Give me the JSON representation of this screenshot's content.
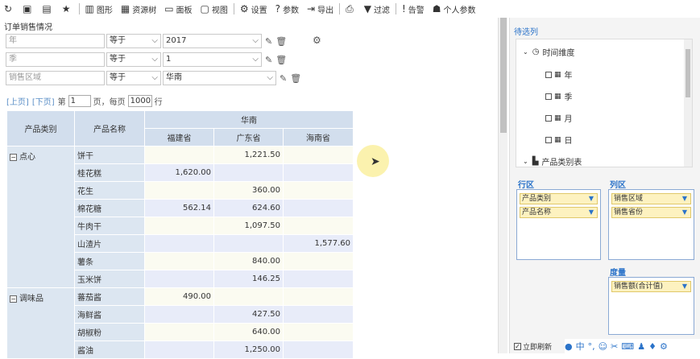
{
  "toolbar": {
    "items": [
      {
        "icon": "refresh-icon",
        "glyph": "↻",
        "label": ""
      },
      {
        "icon": "save-icon",
        "glyph": "▣",
        "label": ""
      },
      {
        "icon": "save-as-icon",
        "glyph": "▤",
        "label": ""
      },
      {
        "icon": "star-icon",
        "glyph": "★",
        "label": ""
      },
      {
        "icon": "chart-icon",
        "glyph": "▥",
        "label": "图形"
      },
      {
        "icon": "resource-tree-icon",
        "glyph": "▦",
        "label": "资源树"
      },
      {
        "icon": "panel-icon",
        "glyph": "▭",
        "label": "面板"
      },
      {
        "icon": "view-icon",
        "glyph": "▢",
        "label": "视图"
      },
      {
        "icon": "settings-icon",
        "glyph": "⚙",
        "label": "设置"
      },
      {
        "icon": "param-icon",
        "glyph": "?",
        "label": "参数"
      },
      {
        "icon": "export-icon",
        "glyph": "⇥",
        "label": "导出"
      },
      {
        "icon": "print-icon",
        "glyph": "⎙",
        "label": ""
      },
      {
        "icon": "filter-icon",
        "glyph": "▼",
        "label": "过滤"
      },
      {
        "icon": "alert-icon",
        "glyph": "!",
        "label": "告警"
      },
      {
        "icon": "user-param-icon",
        "glyph": "☗",
        "label": "个人参数"
      }
    ]
  },
  "report_title": "订单销售情况",
  "filters": [
    {
      "field": "年",
      "operator": "等于",
      "value": "2017"
    },
    {
      "field": "季",
      "operator": "等于",
      "value": "1"
    },
    {
      "field": "销售区域",
      "operator": "等于",
      "value": "华南"
    }
  ],
  "pager": {
    "prev": "[上页]",
    "next": "[下页]",
    "page_label": "第",
    "page_value": "1",
    "page_unit": "页，每页",
    "per_page_value": "1000",
    "row_unit": "行"
  },
  "table": {
    "header_category": "产品类别",
    "header_name": "产品名称",
    "region": "华南",
    "provinces": [
      "福建省",
      "广东省",
      "海南省"
    ],
    "groups": [
      {
        "category": "点心",
        "rows": [
          {
            "name": "饼干",
            "values": [
              "",
              "1,221.50",
              ""
            ]
          },
          {
            "name": "桂花糕",
            "values": [
              "1,620.00",
              "",
              ""
            ]
          },
          {
            "name": "花生",
            "values": [
              "",
              "360.00",
              ""
            ]
          },
          {
            "name": "棉花糖",
            "values": [
              "562.14",
              "624.60",
              ""
            ]
          },
          {
            "name": "牛肉干",
            "values": [
              "",
              "1,097.50",
              ""
            ]
          },
          {
            "name": "山渣片",
            "values": [
              "",
              "",
              "1,577.60"
            ]
          },
          {
            "name": "薯条",
            "values": [
              "",
              "840.00",
              ""
            ]
          },
          {
            "name": "玉米饼",
            "values": [
              "",
              "146.25",
              ""
            ]
          }
        ]
      },
      {
        "category": "调味品",
        "rows": [
          {
            "name": "蕃茄酱",
            "values": [
              "490.00",
              "",
              ""
            ]
          },
          {
            "name": "海鲜酱",
            "values": [
              "",
              "427.50",
              ""
            ]
          },
          {
            "name": "胡椒粉",
            "values": [
              "",
              "640.00",
              ""
            ]
          },
          {
            "name": "酱油",
            "values": [
              "",
              "1,250.00",
              ""
            ]
          }
        ]
      }
    ]
  },
  "right_panel": {
    "title": "待选列",
    "tree": [
      {
        "label": "时间维度",
        "type": "group"
      },
      {
        "label": "年",
        "type": "leaf"
      },
      {
        "label": "季",
        "type": "leaf"
      },
      {
        "label": "月",
        "type": "leaf"
      },
      {
        "label": "日",
        "type": "leaf"
      },
      {
        "label": "产品类别表",
        "type": "group"
      }
    ],
    "row_zone": {
      "label": "行区",
      "chips": [
        "产品类别",
        "产品名称"
      ]
    },
    "col_zone": {
      "label": "列区",
      "chips": [
        "销售区域",
        "销售省份"
      ]
    },
    "measure_zone": {
      "label": "度量",
      "chips": [
        "销售额(合计值)"
      ]
    },
    "refresh_label": "立即刷新",
    "ime_char": "中"
  },
  "colors": {
    "accent": "#2b73c9",
    "header_bg": "#d2deed",
    "chip_bg": "#fdf2c0"
  }
}
